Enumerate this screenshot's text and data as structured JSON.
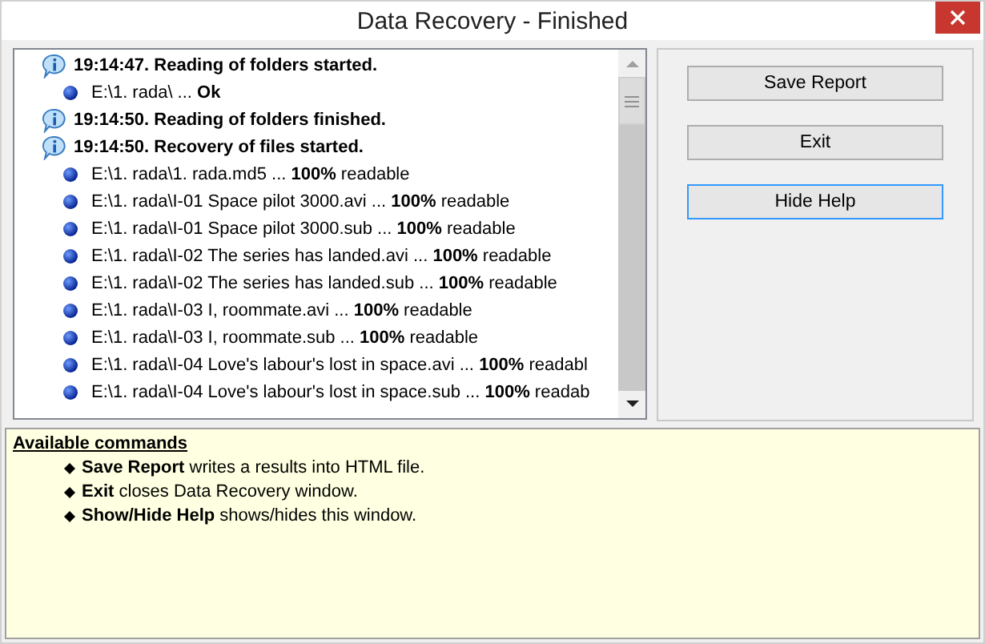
{
  "window": {
    "title": "Data Recovery - Finished"
  },
  "log": [
    {
      "kind": "info",
      "text": "19:14:47. Reading of folders started."
    },
    {
      "kind": "file",
      "text": "E:\\1. rada\\ ... **Ok**"
    },
    {
      "kind": "info",
      "text": "19:14:50. Reading of folders finished."
    },
    {
      "kind": "info",
      "text": "19:14:50. Recovery of files started."
    },
    {
      "kind": "file",
      "text": "E:\\1. rada\\1. rada.md5 ... **100%** readable"
    },
    {
      "kind": "file",
      "text": "E:\\1. rada\\I-01 Space pilot 3000.avi ... **100%** readable"
    },
    {
      "kind": "file",
      "text": "E:\\1. rada\\I-01 Space pilot 3000.sub ... **100%** readable"
    },
    {
      "kind": "file",
      "text": "E:\\1. rada\\I-02 The series has landed.avi ... **100%** readable"
    },
    {
      "kind": "file",
      "text": "E:\\1. rada\\I-02 The series has landed.sub ... **100%** readable"
    },
    {
      "kind": "file",
      "text": "E:\\1. rada\\I-03 I, roommate.avi ... **100%** readable"
    },
    {
      "kind": "file",
      "text": "E:\\1. rada\\I-03 I, roommate.sub ... **100%** readable"
    },
    {
      "kind": "file",
      "text": "E:\\1. rada\\I-04 Love's labour's lost in space.avi ... **100%** readabl"
    },
    {
      "kind": "file",
      "text": "E:\\1. rada\\I-04 Love's labour's lost in space.sub ... **100%** readab"
    }
  ],
  "buttons": [
    {
      "label": "Save Report",
      "focused": false
    },
    {
      "label": "Exit",
      "focused": false
    },
    {
      "label": "Hide Help",
      "focused": true
    }
  ],
  "help": {
    "heading": "Available commands",
    "items": [
      "**Save Report** writes a results into HTML file.",
      "**Exit** closes Data Recovery window.",
      "**Show/Hide Help** shows/hides this window."
    ]
  }
}
